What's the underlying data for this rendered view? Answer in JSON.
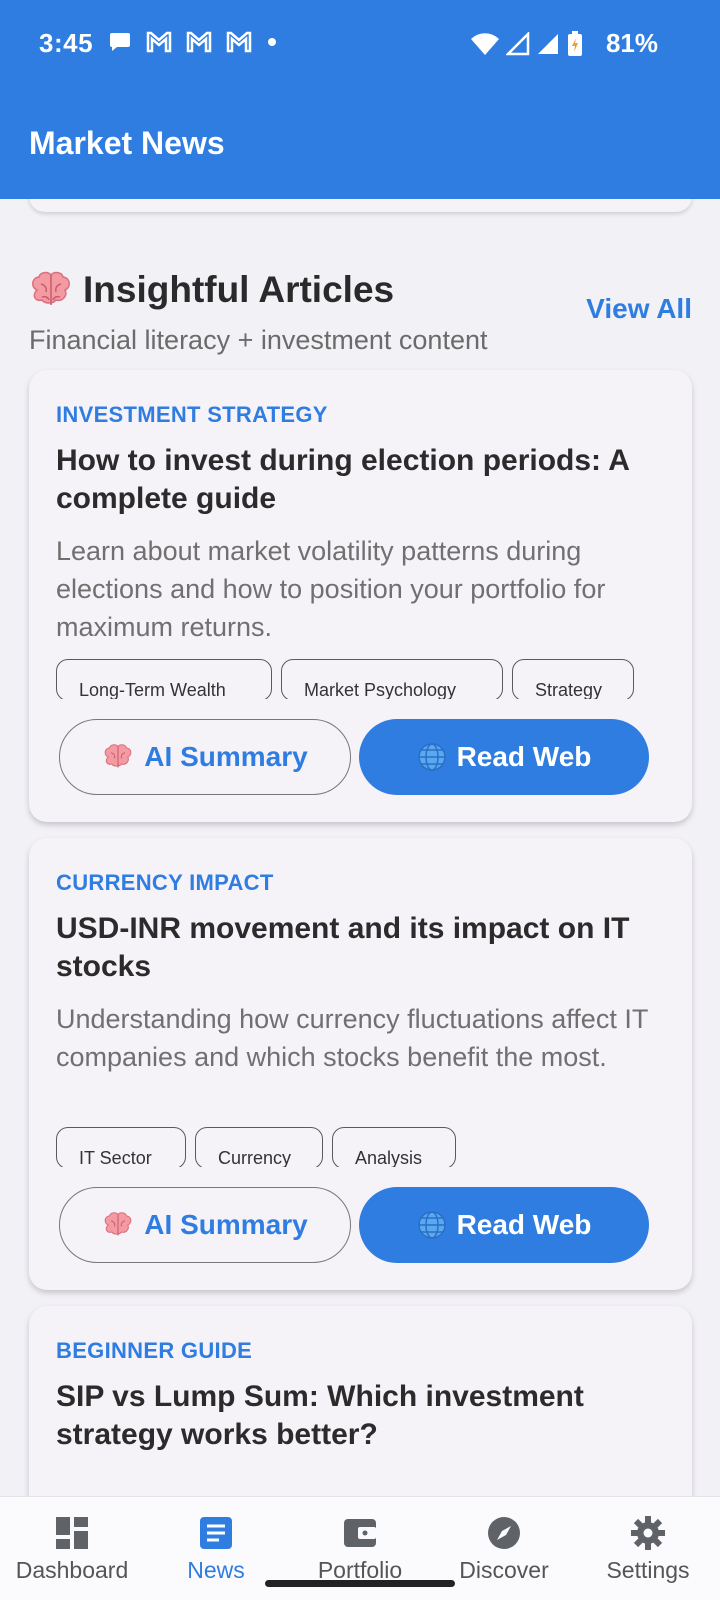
{
  "status_bar": {
    "time": "3:45",
    "battery": "81%"
  },
  "app_bar": {
    "title": "Market News"
  },
  "section": {
    "title": "Insightful Articles",
    "subtitle": "Financial literacy + investment content",
    "view_all": "View All"
  },
  "articles": [
    {
      "category": "INVESTMENT STRATEGY",
      "title": "How to invest during election periods: A complete guide",
      "description": "Learn about market volatility patterns during elections and how to position your portfolio for maximum returns.",
      "tags": [
        "Long-Term Wealth",
        "Market Psychology",
        "Strategy"
      ],
      "ai_button": "AI Summary",
      "web_button": "Read Web"
    },
    {
      "category": "CURRENCY IMPACT",
      "title": "USD-INR movement and its impact on IT stocks",
      "description": "Understanding how currency fluctuations affect IT companies and which stocks benefit the most.",
      "tags": [
        "IT Sector",
        "Currency",
        "Analysis"
      ],
      "ai_button": "AI Summary",
      "web_button": "Read Web"
    },
    {
      "category": "BEGINNER GUIDE",
      "title": "SIP vs Lump Sum: Which investment strategy works better?"
    }
  ],
  "bottom_nav": {
    "items": [
      {
        "label": "Dashboard",
        "icon": "dashboard-icon"
      },
      {
        "label": "News",
        "icon": "news-icon",
        "active": true
      },
      {
        "label": "Portfolio",
        "icon": "wallet-icon"
      },
      {
        "label": "Discover",
        "icon": "compass-icon"
      },
      {
        "label": "Settings",
        "icon": "gear-icon"
      }
    ]
  },
  "colors": {
    "primary": "#2f7de1",
    "background": "#f2f1f6",
    "card": "#f5f2f8"
  }
}
